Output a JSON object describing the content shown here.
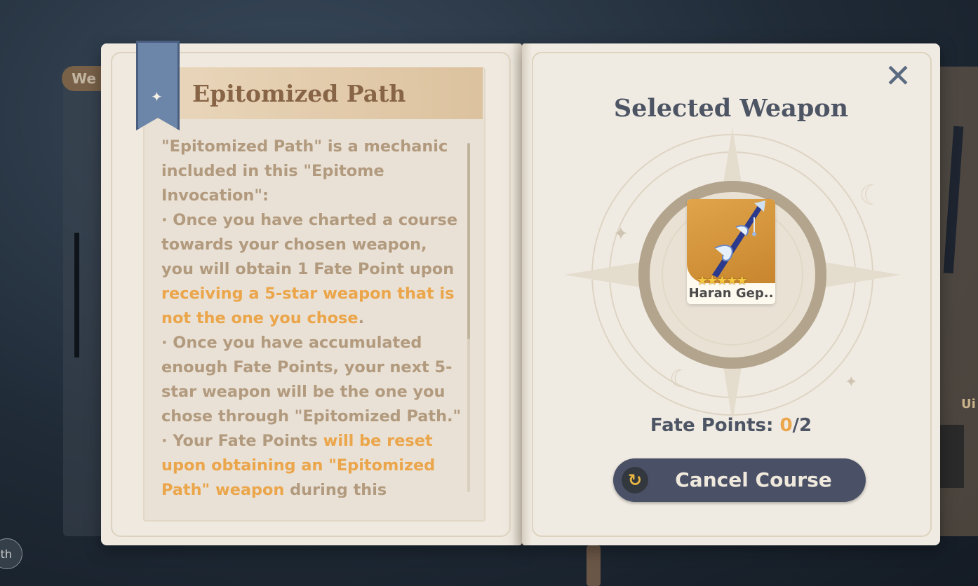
{
  "background": {
    "tab_label": "We",
    "right_label": "Ui",
    "pill_label": "th"
  },
  "left_page": {
    "title": "Epitomized Path",
    "paragraphs": [
      [
        {
          "t": "\"Epitomized Path\" is a mechanic included in this \"Epitome Invocation\":"
        }
      ],
      [
        {
          "t": " · Once you have charted a course towards your chosen weapon, you will obtain 1 Fate Point upon "
        },
        {
          "t": "receiving a 5-star weapon that is not the one you chose",
          "hl": true
        },
        {
          "t": "."
        }
      ],
      [
        {
          "t": " · Once you have accumulated enough Fate Points, your next 5-star weapon will be the one you chose through \"Epitomized Path.\""
        }
      ],
      [
        {
          "t": " · Your Fate Points "
        },
        {
          "t": "will be reset upon obtaining an \"Epitomized Path\" weapon",
          "hl": true
        },
        {
          "t": " during this \"Epitome"
        }
      ]
    ]
  },
  "right_page": {
    "title": "Selected Weapon",
    "weapon": {
      "name": "Haran Gep..",
      "stars": "★★★★★",
      "rarity": 5
    },
    "fate_label": "Fate Points:",
    "fate_current": "0",
    "fate_total": "/2",
    "cancel_label": "Cancel Course",
    "cancel_icon": "refresh-icon",
    "close_icon": "close-icon"
  },
  "colors": {
    "highlight": "#eba54a",
    "title_brown": "#876445",
    "body_text": "#b29a7e",
    "button_bg": "#4a5166"
  }
}
